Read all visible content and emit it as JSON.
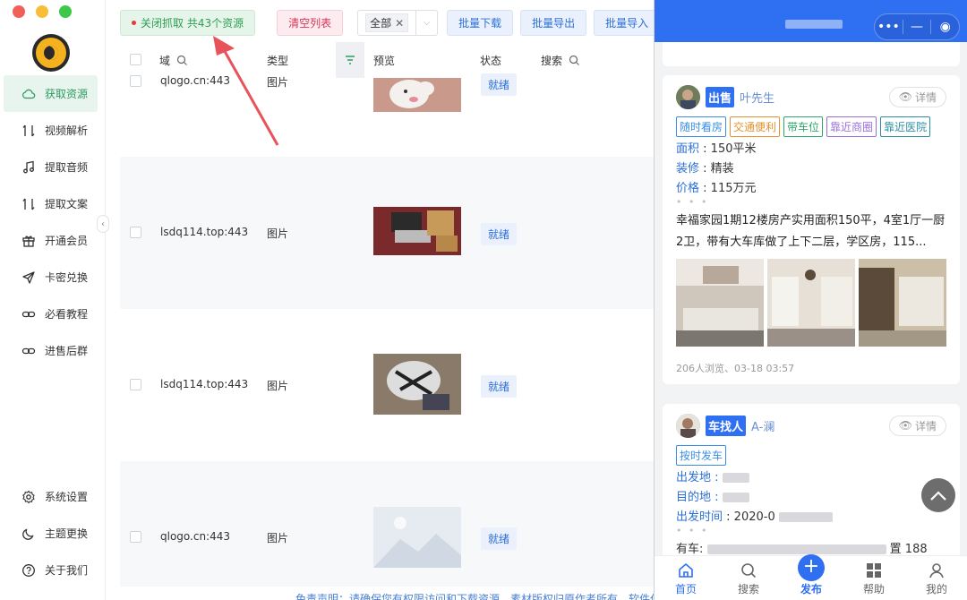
{
  "sidebar": {
    "items": [
      {
        "label": "获取资源",
        "icon": "cloud-icon",
        "active": true
      },
      {
        "label": "视频解析",
        "icon": "swap-icon"
      },
      {
        "label": "提取音频",
        "icon": "music-note-icon"
      },
      {
        "label": "提取文案",
        "icon": "swap-icon"
      },
      {
        "label": "开通会员",
        "icon": "gift-icon"
      },
      {
        "label": "卡密兑换",
        "icon": "send-icon"
      },
      {
        "label": "必看教程",
        "icon": "link-icon"
      },
      {
        "label": "进售后群",
        "icon": "link-icon"
      }
    ],
    "bottom": [
      {
        "label": "系统设置",
        "icon": "gear-icon"
      },
      {
        "label": "主题更换",
        "icon": "moon-icon"
      },
      {
        "label": "关于我们",
        "icon": "question-icon"
      }
    ]
  },
  "toolbar": {
    "capture": "关闭抓取 共43个资源",
    "clear": "清空列表",
    "filter_value": "全部",
    "batch_download": "批量下载",
    "batch_export": "批量导出",
    "batch_import": "批量导入"
  },
  "table": {
    "headers": {
      "domain": "域",
      "type": "类型",
      "preview": "预览",
      "status": "状态",
      "search": "搜索"
    },
    "rows": [
      {
        "domain": "qlogo.cn:443",
        "type": "图片",
        "status": "就绪"
      },
      {
        "domain": "lsdq114.top:443",
        "type": "图片",
        "status": "就绪"
      },
      {
        "domain": "lsdq114.top:443",
        "type": "图片",
        "status": "就绪"
      },
      {
        "domain": "qlogo.cn:443",
        "type": "图片",
        "status": "就绪"
      }
    ]
  },
  "footer_note": "免责声明：请确保您有权限访问和下载资源，素材版权归原作者所有，软件仅供学习交流，严禁非法使用",
  "panel": {
    "card1": {
      "kind": "出售",
      "name": "叶先生",
      "detail": "详情",
      "tags": [
        {
          "text": "随时看房",
          "color": "#3a8ee6"
        },
        {
          "text": "交通便利",
          "color": "#e6922e"
        },
        {
          "text": "带车位",
          "color": "#2aa86b"
        },
        {
          "text": "靠近商圈",
          "color": "#9b6fd8"
        },
        {
          "text": "靠近医院",
          "color": "#2b8fa3"
        }
      ],
      "area_k": "面积",
      "area_v": "150平米",
      "deco_k": "装修",
      "deco_v": "精装",
      "price_k": "价格",
      "price_v": "115万元",
      "desc": "幸福家园1期12楼房产实用面积150平，4室1厅一厨2卫，带有大车库做了上下二层，学区房，115...",
      "meta": "206人浏览、03-18 03:57"
    },
    "card2": {
      "kind": "车找人",
      "name": "A-澜",
      "detail": "详情",
      "tag": "按时发车",
      "from_k": "出发地",
      "to_k": "目的地",
      "time_k": "出发时间",
      "time_v": "2020-0",
      "car_k": "有车",
      "car_tail": "置 188"
    },
    "tabs": [
      {
        "label": "首页",
        "icon": "home-icon",
        "active": true
      },
      {
        "label": "搜索",
        "icon": "search-icon"
      },
      {
        "label": "发布",
        "icon": "plus-icon",
        "active": true
      },
      {
        "label": "帮助",
        "icon": "grid-icon"
      },
      {
        "label": "我的",
        "icon": "user-icon"
      }
    ]
  }
}
